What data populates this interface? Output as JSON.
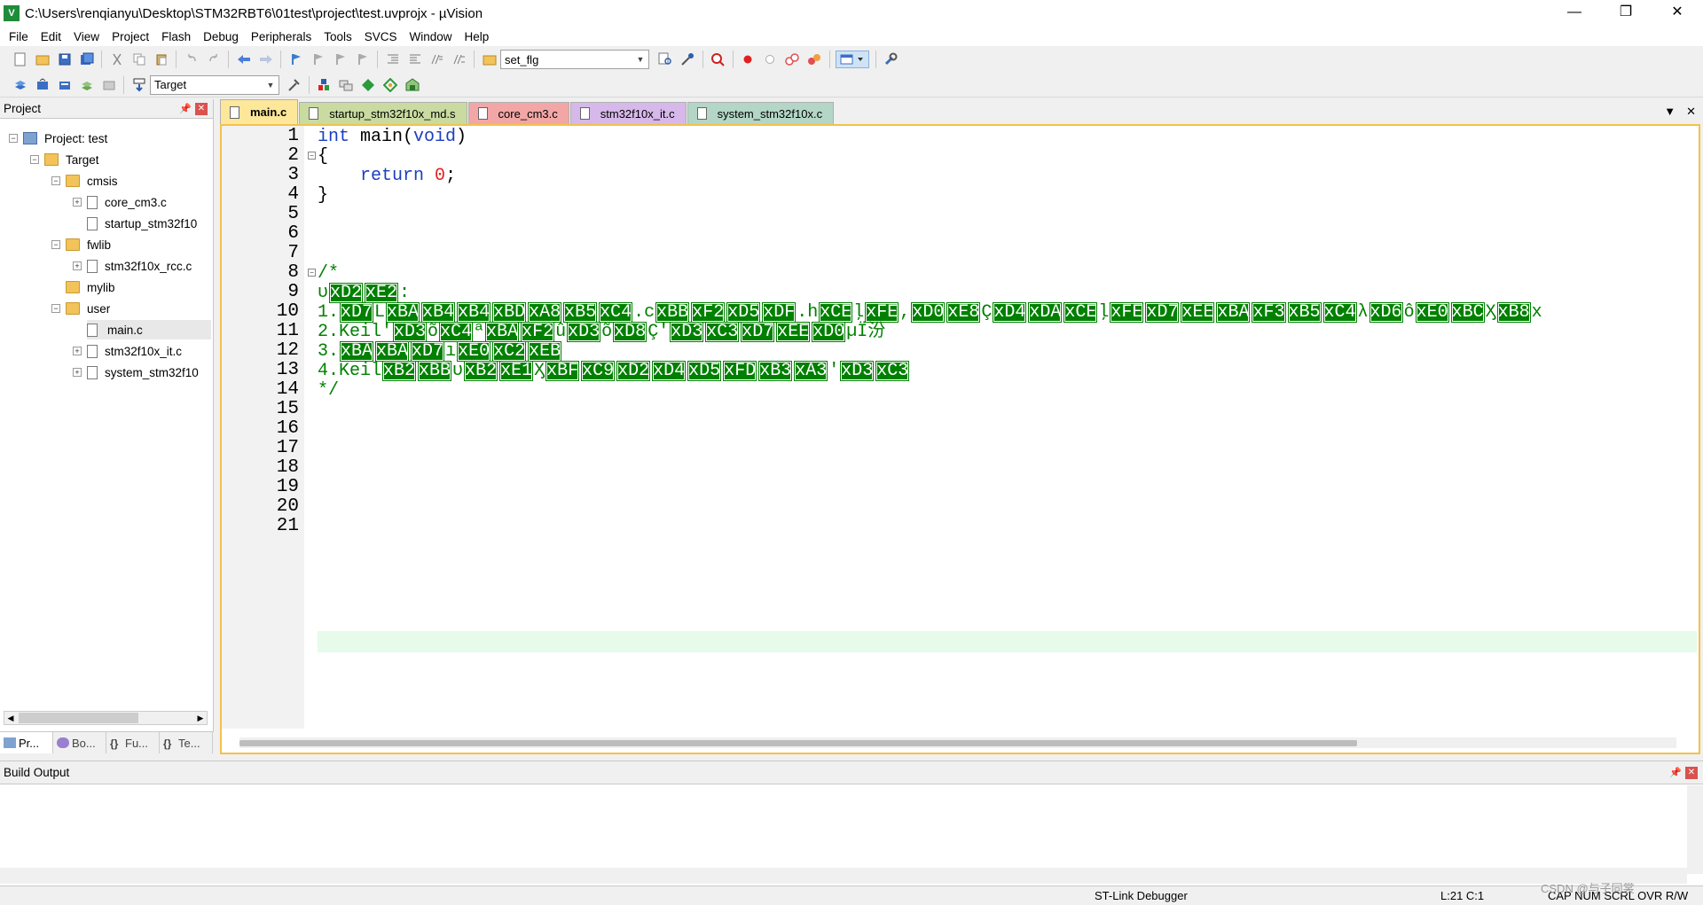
{
  "window": {
    "title": "C:\\Users\\renqianyu\\Desktop\\STM32RBT6\\01test\\project\\test.uvprojx - µVision",
    "app_icon_letter": "V",
    "minimize": "—",
    "restore": "❐",
    "close": "✕"
  },
  "menu": [
    "File",
    "Edit",
    "View",
    "Project",
    "Flash",
    "Debug",
    "Peripherals",
    "Tools",
    "SVCS",
    "Window",
    "Help"
  ],
  "toolbar": {
    "find_value": "set_flg",
    "target_value": "Target"
  },
  "project_panel": {
    "title": "Project",
    "tree": [
      {
        "label": "Project: test"
      },
      {
        "label": "Target"
      },
      {
        "label": "cmsis"
      },
      {
        "label": "core_cm3.c"
      },
      {
        "label": "startup_stm32f10"
      },
      {
        "label": "fwlib"
      },
      {
        "label": "stm32f10x_rcc.c"
      },
      {
        "label": "mylib"
      },
      {
        "label": "user"
      },
      {
        "label": "main.c"
      },
      {
        "label": "stm32f10x_it.c"
      },
      {
        "label": "system_stm32f10"
      }
    ],
    "tabs": [
      "Pr...",
      "Bo...",
      "Fu...",
      "Te..."
    ]
  },
  "editor": {
    "tabs": [
      {
        "label": "main.c",
        "color": "#fde79a"
      },
      {
        "label": "startup_stm32f10x_md.s",
        "color": "#c9dba0"
      },
      {
        "label": "core_cm3.c",
        "color": "#f3a6a6"
      },
      {
        "label": "stm32f10x_it.c",
        "color": "#d7b8ea"
      },
      {
        "label": "system_stm32f10x.c",
        "color": "#b3d6c6"
      }
    ],
    "line_numbers": [
      "1",
      "2",
      "3",
      "4",
      "5",
      "6",
      "7",
      "8",
      "9",
      "10",
      "11",
      "12",
      "13",
      "14",
      "15",
      "16",
      "17",
      "18",
      "19",
      "20",
      "21"
    ],
    "code": {
      "l1_kw": "int",
      "l1_mid": " main(",
      "l1_kw2": "void",
      "l1_end": ")",
      "l2": "{",
      "l3_kw": "return",
      "l3_num": "0",
      "l3_end": ";",
      "l4": "}",
      "l8": "/*",
      "l9": [
        "υ",
        "xD2",
        "xE2",
        ":"
      ],
      "l10": [
        "1.",
        "xD7",
        "L",
        "xBA",
        "xB4",
        "xB4",
        "xBD",
        "xA8",
        "xB5",
        "xC4",
        ".c",
        "xBB",
        "xF2",
        "xD5",
        "xDF",
        ".h",
        "xCE",
        "ļ",
        "xFE",
        ",",
        "xD0",
        "xE8",
        "Ç",
        "xD4",
        "xDA",
        "xCE",
        "ļ",
        "xFE",
        "xD7",
        "xEE",
        "xBA",
        "xF3",
        "xB5",
        "xC4",
        "λ",
        "xD6",
        "ô",
        "xE0",
        "xBC",
        "Ӽ",
        "xB8",
        "x"
      ],
      "l11": [
        "2.Keil",
        "'",
        "xD3",
        "õ",
        "xC4",
        "ª",
        "xBA",
        "xF2",
        "û",
        "xD3",
        "õ",
        "xD8",
        "Ç'",
        "xD3",
        "xC3",
        "xD7",
        "xEE",
        "xD0",
        "µ",
        "Ϊ汾"
      ],
      "l12": [
        "3.",
        "xBA",
        "xBA",
        "xD7",
        "ı",
        "xE0",
        "xC2",
        "xEB"
      ],
      "l13": [
        "4.Keil",
        "xB2",
        "xBB",
        "υ",
        "xB2",
        "xE1",
        "Ӽ",
        "xBF",
        "xC9",
        "xD2",
        "xD4",
        "xD5",
        "xFD",
        "xB3",
        "xA3",
        "'",
        "xD3",
        "xC3"
      ],
      "l14": "*/"
    }
  },
  "build_output": {
    "title": "Build Output"
  },
  "statusbar": {
    "debugger": "ST-Link Debugger",
    "position": "L:21 C:1",
    "flags": "CAP  NUM  SCRL  OVR  R/W",
    "watermark": "CSDN @与子同裳"
  }
}
